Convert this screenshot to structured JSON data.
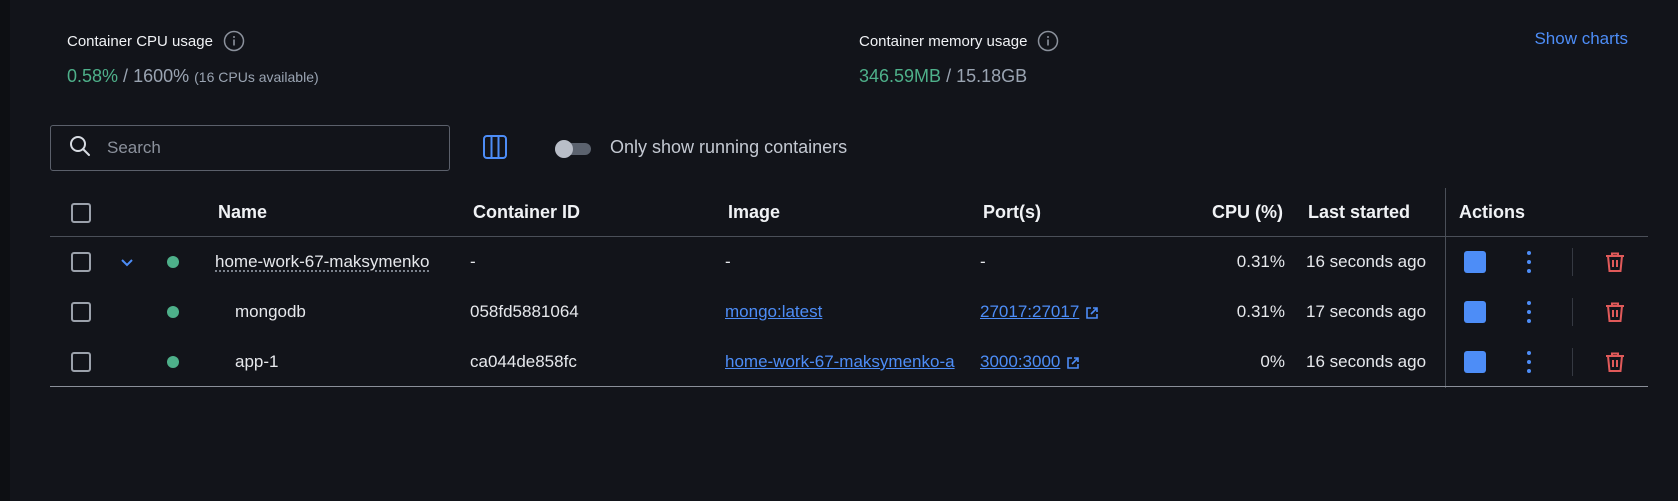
{
  "stats": {
    "cpu": {
      "label": "Container CPU usage",
      "used": "0.58%",
      "sep": " / ",
      "total": "1600%",
      "note": "(16 CPUs available)"
    },
    "memory": {
      "label": "Container memory usage",
      "used": "346.59MB",
      "sep": " / ",
      "total": "15.18GB"
    },
    "show_charts": "Show charts"
  },
  "toolbar": {
    "search_placeholder": "Search",
    "toggle_label": "Only show running containers",
    "toggle_on": false
  },
  "table": {
    "headers": {
      "name": "Name",
      "container_id": "Container ID",
      "image": "Image",
      "ports": "Port(s)",
      "cpu": "CPU (%)",
      "last_started": "Last started",
      "actions": "Actions"
    },
    "rows": [
      {
        "name": "home-work-67-maksymenko",
        "container_id": "-",
        "image": "-",
        "ports": "-",
        "cpu": "0.31%",
        "last_started": "16 seconds ago"
      },
      {
        "name": "mongodb",
        "container_id": "058fd5881064",
        "image": "mongo:latest",
        "ports": "27017:27017",
        "cpu": "0.31%",
        "last_started": "17 seconds ago"
      },
      {
        "name": "app-1",
        "container_id": "ca044de858fc",
        "image": "home-work-67-maksymenko-a",
        "ports": "3000:3000",
        "cpu": "0%",
        "last_started": "16 seconds ago"
      }
    ]
  },
  "colors": {
    "accent": "#4d8df7",
    "running": "#4eb08a",
    "danger": "#e05a5a",
    "background": "#12141a"
  },
  "icons": [
    "info-icon",
    "search-icon",
    "columns-icon",
    "chevron-down-icon",
    "external-link-icon",
    "stop-icon",
    "more-vertical-icon",
    "trash-icon"
  ]
}
